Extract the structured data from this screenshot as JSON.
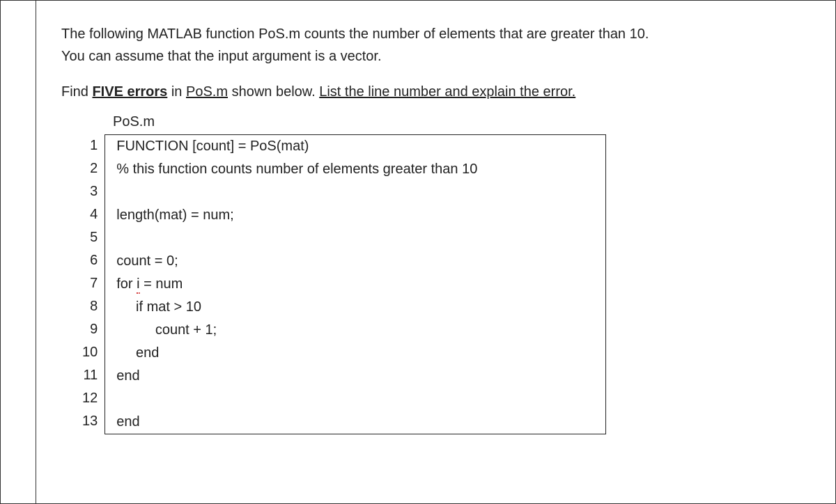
{
  "intro": {
    "line1": "The following MATLAB function PoS.m counts the number of elements that are greater than 10.",
    "line2": "You can assume that the input argument is a vector."
  },
  "instruction": {
    "prefix": "Find ",
    "five_errors": "FIVE errors",
    "middle": " in ",
    "pos_m": "PoS.m",
    "after": " shown below. ",
    "list_part": "List the line number and explain the error."
  },
  "filename": "PoS.m",
  "code": {
    "lines": [
      "FUNCTION [count] = PoS(mat)",
      "% this function counts number of elements greater than 10",
      "",
      "length(mat) = num;",
      "",
      "count = 0;",
      "for i = num",
      "     if mat > 10",
      "          count + 1;",
      "     end",
      "end",
      "",
      "end"
    ]
  },
  "line_numbers": [
    "1",
    "2",
    "3",
    "4",
    "5",
    "6",
    "7",
    "8",
    "9",
    "10",
    "11",
    "12",
    "13"
  ]
}
